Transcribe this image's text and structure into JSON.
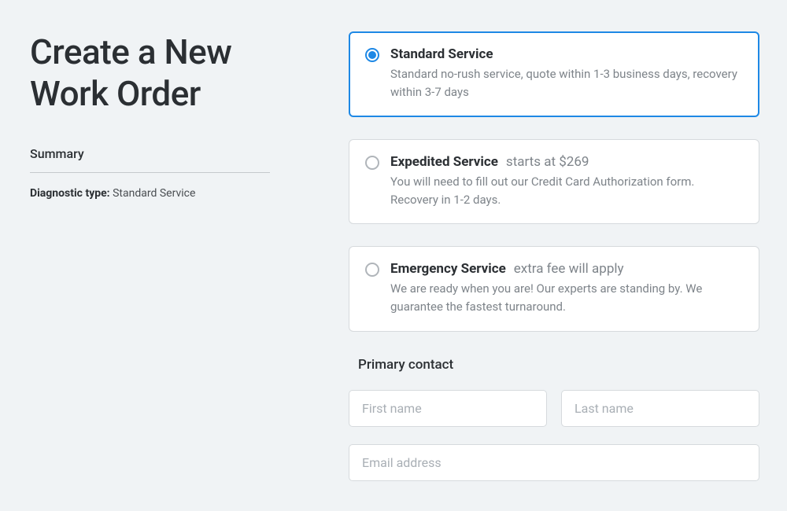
{
  "header": {
    "title": "Create a New Work Order"
  },
  "summary": {
    "heading": "Summary",
    "diagnostic_label": "Diagnostic type:",
    "diagnostic_value": "Standard Service"
  },
  "services": [
    {
      "title": "Standard Service",
      "subtitle": "",
      "description": "Standard no-rush service, quote within 1-3 business days, recovery within 3-7 days",
      "selected": true
    },
    {
      "title": "Expedited Service",
      "subtitle": "starts at $269",
      "description": "You will need to fill out our Credit Card Authorization form. Recovery in 1-2 days.",
      "selected": false
    },
    {
      "title": "Emergency Service",
      "subtitle": "extra fee will apply",
      "description": "We are ready when you are! Our experts are standing by. We guarantee the fastest turnaround.",
      "selected": false
    }
  ],
  "contact": {
    "heading": "Primary contact",
    "first_name_placeholder": "First name",
    "last_name_placeholder": "Last name",
    "email_placeholder": "Email address"
  }
}
